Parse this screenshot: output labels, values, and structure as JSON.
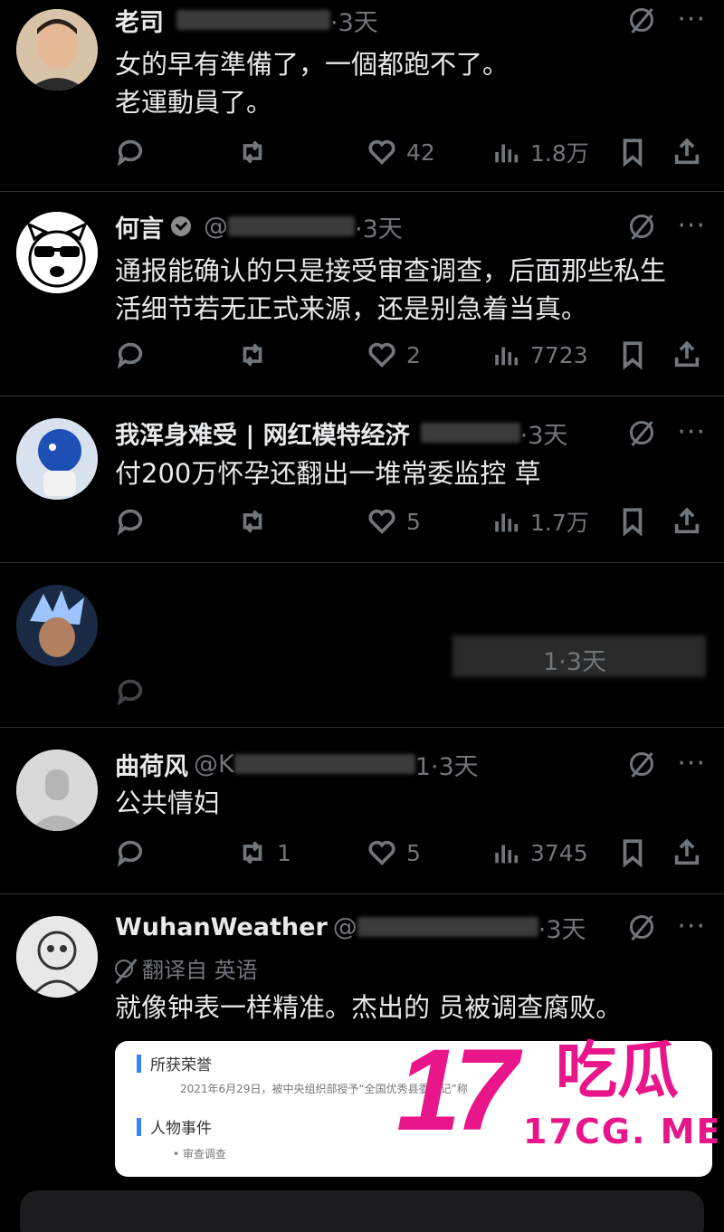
{
  "replies": [
    {
      "name": "老司",
      "time": "·3天",
      "text": [
        "女的早有準備了，一個都跑不了。",
        "老運動員了。"
      ],
      "stats": {
        "reply": "",
        "retweet": "",
        "like": "42",
        "views": "1.8万"
      }
    },
    {
      "name": "何言",
      "handle": "@",
      "time": "·3天",
      "text": [
        "通报能确认的只是接受审查调查，后面那些私生",
        "活细节若无正式来源，还是别急着当真。"
      ],
      "stats": {
        "reply": "",
        "retweet": "",
        "like": "2",
        "views": "7723"
      }
    },
    {
      "name": "我浑身难受 | 网红模特经济",
      "time": "·3天",
      "text": [
        "付200万怀孕还翻出一堆常委监控 草"
      ],
      "stats": {
        "reply": "",
        "retweet": "",
        "like": "5",
        "views": "1.7万"
      }
    },
    {
      "time": "1·3天"
    },
    {
      "name": "曲荷风",
      "handle": "@K",
      "time": "1·3天",
      "text": [
        "公共情妇"
      ],
      "stats": {
        "reply": "",
        "retweet": "1",
        "like": "5",
        "views": "3745"
      }
    },
    {
      "name": "WuhanWeather",
      "handle": "@",
      "time": "·3天",
      "translated": "翻译自 英语",
      "text": [
        "就像钟表一样精准。杰出的 员被调查腐败。"
      ]
    }
  ],
  "card": {
    "section1": "所获荣誉",
    "line1": "2021年6月29日，被中央组织部授予“全国优秀县委书记”称",
    "section2": "人物事件",
    "bullet": "审查调查"
  },
  "watermark": {
    "big": "17",
    "cn": "吃瓜",
    "url": "17CG. ME"
  },
  "colors": {
    "bg": "#000000",
    "text": "#e7e9ea",
    "muted": "#71767b",
    "accent": "#e8168a"
  }
}
